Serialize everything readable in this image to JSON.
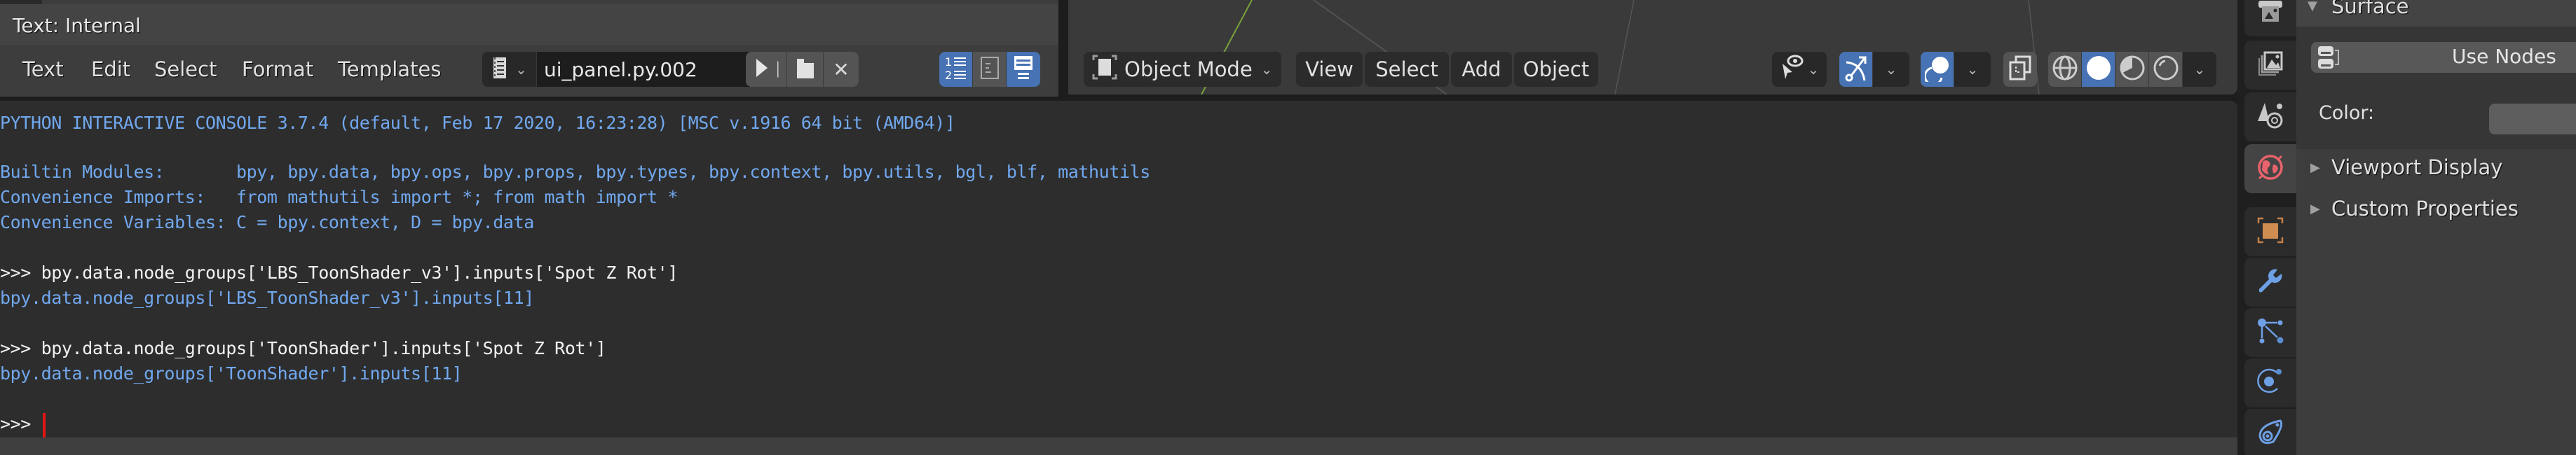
{
  "text_editor": {
    "title": "Text: Internal",
    "menu": [
      "Text",
      "Edit",
      "Select",
      "Format",
      "Templates"
    ],
    "file_name": "ui_panel.py.002",
    "icons": {
      "text_browse": "text-datablock-icon",
      "new": "new-file-icon",
      "open": "open-folder-icon",
      "unlink": "close-icon",
      "run": "play-icon",
      "line_numbers": "line-numbers-icon",
      "word_wrap": "word-wrap-icon",
      "syntax_highlight": "syntax-highlight-icon"
    },
    "toggles": {
      "line_numbers": true,
      "word_wrap": false,
      "syntax_highlight": true
    }
  },
  "viewport": {
    "mode": "Object Mode",
    "menu": [
      "View",
      "Select",
      "Add",
      "Object"
    ],
    "toggles": {
      "gizmo": true,
      "overlays": true,
      "xray": false
    },
    "shading": [
      "wireframe",
      "solid",
      "material",
      "rendered"
    ],
    "active_shading": "solid"
  },
  "console": {
    "lines": [
      {
        "kind": "out",
        "text": "PYTHON INTERACTIVE CONSOLE 3.7.4 (default, Feb 17 2020, 16:23:28) [MSC v.1916 64 bit (AMD64)]"
      },
      {
        "kind": "out",
        "text": ""
      },
      {
        "kind": "out",
        "text": "Builtin Modules:       bpy, bpy.data, bpy.ops, bpy.props, bpy.types, bpy.context, bpy.utils, bgl, blf, mathutils"
      },
      {
        "kind": "out",
        "text": "Convenience Imports:   from mathutils import *; from math import *"
      },
      {
        "kind": "out",
        "text": "Convenience Variables: C = bpy.context, D = bpy.data"
      },
      {
        "kind": "out",
        "text": ""
      },
      {
        "kind": "in",
        "text": ">>> bpy.data.node_groups['LBS_ToonShader_v3'].inputs['Spot Z Rot']"
      },
      {
        "kind": "out",
        "text": "bpy.data.node_groups['LBS_ToonShader_v3'].inputs[11]"
      },
      {
        "kind": "out",
        "text": ""
      },
      {
        "kind": "in",
        "text": ">>> bpy.data.node_groups['ToonShader'].inputs['Spot Z Rot']"
      },
      {
        "kind": "out",
        "text": "bpy.data.node_groups['ToonShader'].inputs[11]"
      },
      {
        "kind": "out",
        "text": ""
      },
      {
        "kind": "in",
        "text": ">>> "
      }
    ],
    "prompt": ">>>"
  },
  "properties": {
    "tabs": [
      "output-icon",
      "view-layer-icon",
      "scene-icon",
      "world-icon",
      "object-icon",
      "modifier-icon",
      "particles-icon",
      "physics-icon",
      "constraints-icon"
    ],
    "active_tab": "world-icon",
    "surface_title": "Surface",
    "use_nodes_label": "Use Nodes",
    "color_label": "Color:",
    "subpanels": [
      "Viewport Display",
      "Custom Properties"
    ]
  },
  "colors": {
    "accent_blue": "#4772b3",
    "console_output": "#71a8ef",
    "console_input": "#f2f2f2",
    "cursor": "#e41515",
    "world_icon": "#e8636c",
    "object_icon": "#d08d52",
    "modifier_icon": "#6ea0e6"
  }
}
